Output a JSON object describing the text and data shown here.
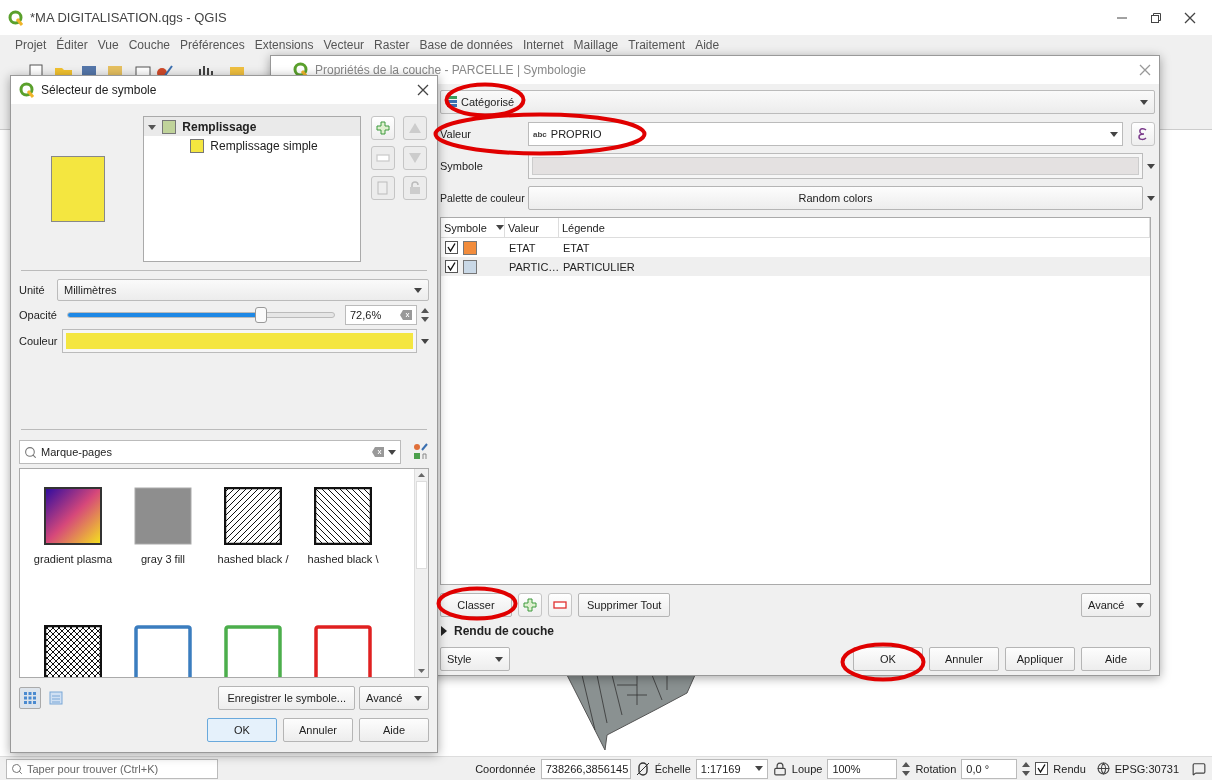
{
  "app": {
    "title": "*MA DIGITALISATION.qgs - QGIS"
  },
  "menu": [
    "Projet",
    "Éditer",
    "Vue",
    "Couche",
    "Préférences",
    "Extensions",
    "Vecteur",
    "Raster",
    "Base de données",
    "Internet",
    "Maillage",
    "Traitement",
    "Aide"
  ],
  "symbol_selector": {
    "title": "Sélecteur de symbole",
    "tree": [
      {
        "label": "Remplissage",
        "expanded": true,
        "selected": true,
        "color": "#c0d39a",
        "children": [
          {
            "label": "Remplissage simple",
            "selected": false,
            "color": "#f4e640"
          }
        ]
      }
    ],
    "unit": {
      "label": "Unité",
      "value": "Millimètres"
    },
    "opacity": {
      "label": "Opacité",
      "level": 0.726,
      "value": "72,6%"
    },
    "color": {
      "label": "Couleur",
      "color": "#f4e640"
    },
    "search": {
      "value": "Marque-pages"
    },
    "library": [
      {
        "kind": "gradient",
        "name": "gradient plasma"
      },
      {
        "kind": "gray",
        "name": "gray 3 fill"
      },
      {
        "kind": "hatch-forward",
        "name": "hashed black /"
      },
      {
        "kind": "hatch-back",
        "name": "hashed black \\"
      },
      {
        "kind": "crosshatch"
      },
      {
        "kind": "outline",
        "color": "#3b7dbf"
      },
      {
        "kind": "outline",
        "color": "#4cae4c"
      },
      {
        "kind": "outline",
        "color": "#e02020"
      }
    ],
    "view_modes": [
      {
        "kind": "icons",
        "selected": true
      },
      {
        "kind": "list",
        "selected": false
      }
    ],
    "save_button": "Enregistrer le symbole...",
    "advanced_button": "Avancé",
    "buttons": [
      {
        "label": "OK",
        "default": true
      },
      {
        "label": "Annuler",
        "default": false
      },
      {
        "label": "Aide",
        "default": false
      }
    ]
  },
  "layer_properties": {
    "title": "Propriétés de la couche - PARCELLE | Symbologie",
    "renderer": "Catégorisé",
    "value": {
      "label": "Valeur",
      "type": "abc",
      "value": "PROPRIO"
    },
    "symbol": {
      "label": "Symbole"
    },
    "palette": {
      "label": "Palette de couleur",
      "value": "Random colors"
    },
    "columns": [
      "Symbole",
      "Valeur",
      "Légende"
    ],
    "rows": [
      {
        "checked": true,
        "color": "#f28c3c",
        "value": "ETAT",
        "legend": "ETAT"
      },
      {
        "checked": true,
        "color": "#c9d8e6",
        "value": "PARTIC…",
        "legend": "PARTICULIER"
      }
    ],
    "classify_button": "Classer",
    "delete_all_button": "Supprimer Tout",
    "advanced_button": "Avancé",
    "layer_rendering": {
      "label": "Rendu de couche",
      "expanded": false
    },
    "style_button": "Style",
    "buttons": [
      {
        "label": "OK",
        "default": false
      },
      {
        "label": "Annuler",
        "default": false
      },
      {
        "label": "Appliquer",
        "default": false
      },
      {
        "label": "Aide",
        "default": false
      }
    ]
  },
  "status_bar": {
    "search_placeholder": "Taper pour trouver (Ctrl+K)",
    "coordinate": {
      "label": "Coordonnée",
      "value": "738266,3856145"
    },
    "scale": {
      "label": "Échelle",
      "value": "1:17169"
    },
    "magnifier": {
      "label": "Loupe",
      "value": "100%"
    },
    "rotation": {
      "label": "Rotation",
      "value": "0,0 °"
    },
    "render": {
      "label": "Rendu",
      "checked": true
    },
    "crs": "EPSG:30731"
  }
}
